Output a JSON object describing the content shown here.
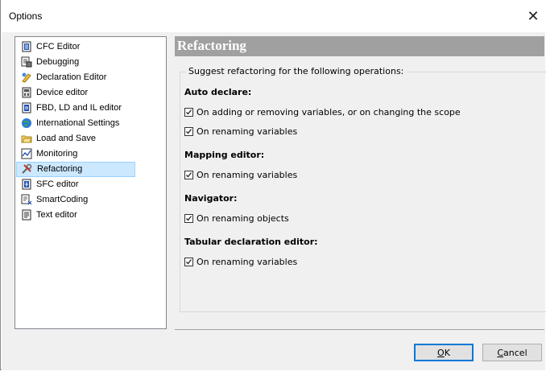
{
  "window": {
    "title": "Options",
    "close_glyph": "✕"
  },
  "tree": {
    "items": [
      {
        "label": "CFC Editor",
        "icon": "cfc-editor-icon",
        "selected": false
      },
      {
        "label": "Debugging",
        "icon": "debugging-icon",
        "selected": false
      },
      {
        "label": "Declaration Editor",
        "icon": "declaration-editor-icon",
        "selected": false
      },
      {
        "label": "Device editor",
        "icon": "device-editor-icon",
        "selected": false
      },
      {
        "label": "FBD, LD and IL editor",
        "icon": "fbd-ld-il-editor-icon",
        "selected": false
      },
      {
        "label": "International Settings",
        "icon": "globe-icon",
        "selected": false
      },
      {
        "label": "Load and Save",
        "icon": "folder-icon",
        "selected": false
      },
      {
        "label": "Monitoring",
        "icon": "monitoring-icon",
        "selected": false
      },
      {
        "label": "Refactoring",
        "icon": "refactoring-tools-icon",
        "selected": true
      },
      {
        "label": "SFC editor",
        "icon": "sfc-editor-icon",
        "selected": false
      },
      {
        "label": "SmartCoding",
        "icon": "smartcoding-icon",
        "selected": false
      },
      {
        "label": "Text editor",
        "icon": "text-editor-icon",
        "selected": false
      }
    ]
  },
  "panel": {
    "title": "Refactoring",
    "group_caption": "Suggest refactoring for the following operations:",
    "sections": [
      {
        "label": "Auto declare:",
        "options": [
          {
            "label": "On adding or removing variables, or on changing the scope",
            "checked": true
          },
          {
            "label": "On renaming variables",
            "checked": true
          }
        ]
      },
      {
        "label": "Mapping editor:",
        "options": [
          {
            "label": "On renaming variables",
            "checked": true
          }
        ]
      },
      {
        "label": "Navigator:",
        "options": [
          {
            "label": "On renaming objects",
            "checked": true
          }
        ]
      },
      {
        "label": "Tabular declaration editor:",
        "options": [
          {
            "label": "On renaming variables",
            "checked": true
          }
        ]
      }
    ]
  },
  "buttons": {
    "ok": {
      "label_first": "O",
      "label_rest": "K"
    },
    "cancel": {
      "label_first": "C",
      "label_rest": "ancel"
    }
  },
  "colors": {
    "selection_bg": "#cce8ff",
    "panel_header_bg": "#a0a0a0",
    "default_button_border": "#0078d7"
  }
}
